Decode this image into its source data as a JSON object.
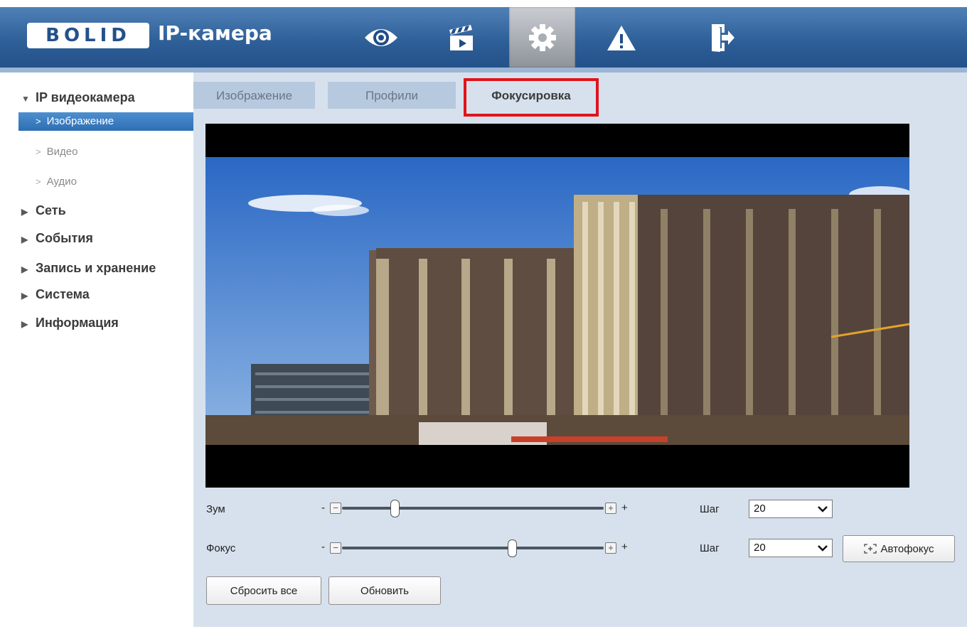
{
  "header": {
    "logo_text": "BOLID",
    "app_title": "IP-камера",
    "nav_icons": [
      "eye-icon",
      "clapperboard-icon",
      "gear-icon",
      "warning-icon",
      "logout-icon"
    ]
  },
  "sidebar": {
    "section_main": "IP видеокамера",
    "sub_items": [
      "Изображение",
      "Видео",
      "Аудио"
    ],
    "sections": [
      "Сеть",
      "События",
      "Запись и хранение",
      "Система",
      "Информация"
    ]
  },
  "tabs": [
    "Изображение",
    "Профили",
    "Фокусировка"
  ],
  "controls": {
    "zoom_label": "Зум",
    "focus_label": "Фокус",
    "minus": "-",
    "plus": "+",
    "step_label": "Шаг",
    "zoom_step_value": "20",
    "focus_step_value": "20",
    "zoom_level": 0.2,
    "focus_level": 0.65,
    "autofocus_button": "Автофокус",
    "reset_button": "Сбросить все",
    "refresh_button": "Обновить"
  },
  "colors": {
    "header": "#2f6099",
    "main_bg": "#d6e1ed",
    "highlight": "#e0141a",
    "active_item": "#2d6fb3"
  }
}
